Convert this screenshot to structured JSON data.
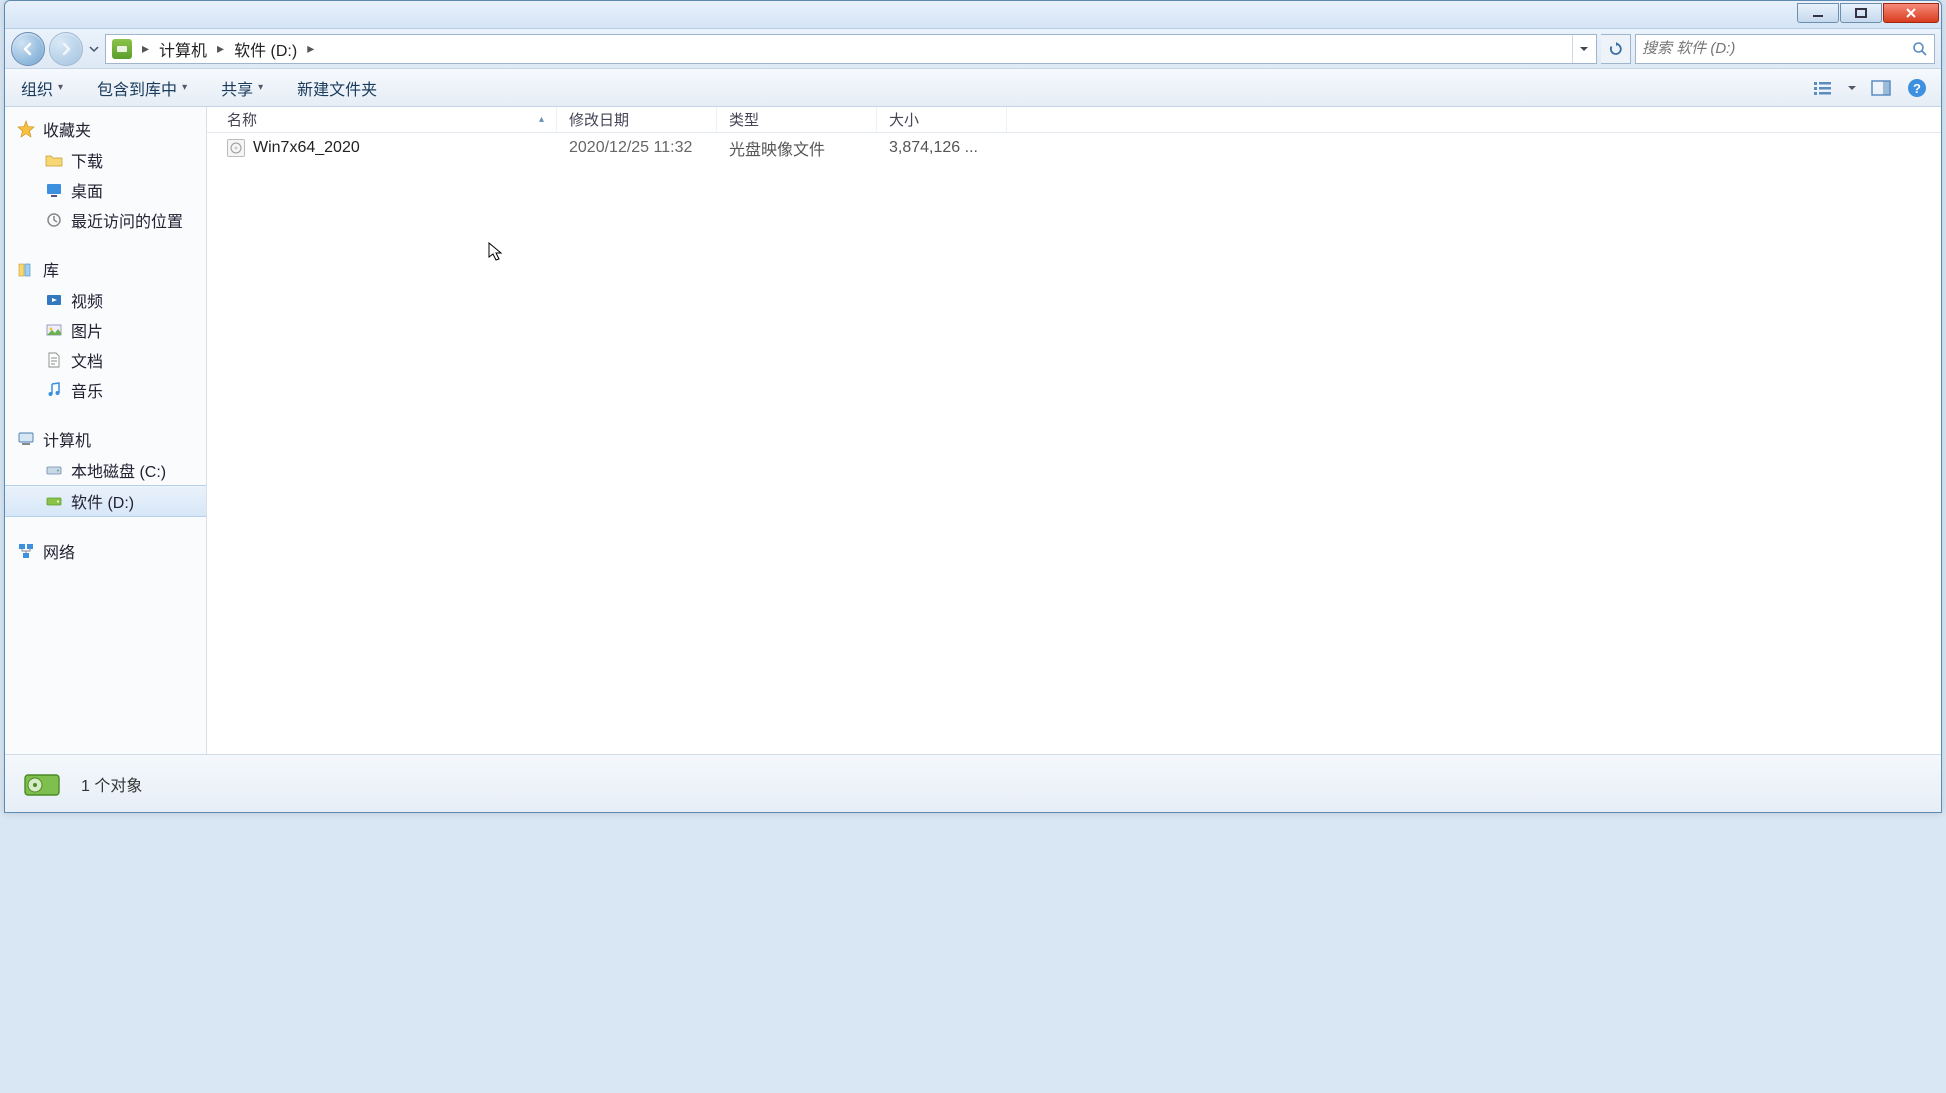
{
  "titlebar": {},
  "breadcrumb": {
    "part1": "计算机",
    "part2": "软件 (D:)"
  },
  "search": {
    "placeholder": "搜索 软件 (D:)"
  },
  "toolbar": {
    "organize": "组织",
    "include": "包含到库中",
    "share": "共享",
    "newfolder": "新建文件夹"
  },
  "columns": {
    "name": "名称",
    "date": "修改日期",
    "type": "类型",
    "size": "大小"
  },
  "sidebar": {
    "favorites": "收藏夹",
    "downloads": "下载",
    "desktop": "桌面",
    "recent": "最近访问的位置",
    "libraries": "库",
    "videos": "视频",
    "pictures": "图片",
    "documents": "文档",
    "music": "音乐",
    "computer": "计算机",
    "localc": "本地磁盘 (C:)",
    "softd": "软件 (D:)",
    "network": "网络"
  },
  "files": [
    {
      "name": "Win7x64_2020",
      "date": "2020/12/25 11:32",
      "type": "光盘映像文件",
      "size": "3,874,126 ..."
    }
  ],
  "status": {
    "text": "1 个对象"
  }
}
